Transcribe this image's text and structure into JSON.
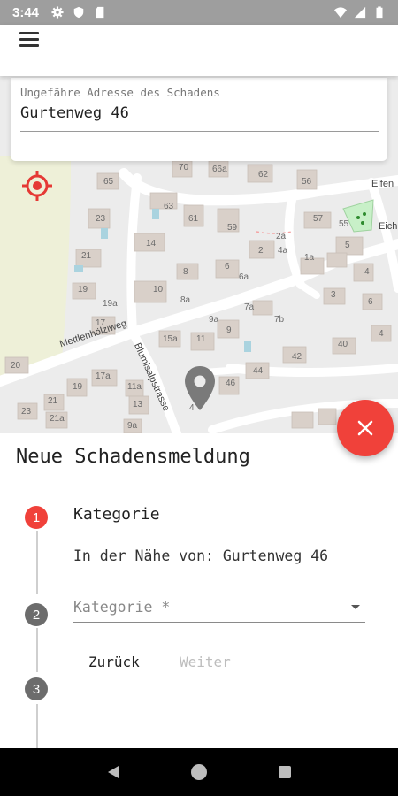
{
  "status_bar": {
    "time": "3:44",
    "left_icons": [
      "gear-icon",
      "shield-icon",
      "sd-card-icon"
    ],
    "right_icons": [
      "wifi-icon",
      "signal-icon",
      "battery-icon"
    ]
  },
  "app_bar": {
    "menu_icon": "hamburger-menu-icon"
  },
  "address": {
    "label": "Ungefähre Adresse des Schadens",
    "value": "Gurtenweg 46"
  },
  "map": {
    "street_labels": [
      "Mettlenhölziweg",
      "Blumisalpstrasse",
      "Elfen",
      "Eich"
    ],
    "house_numbers": [
      "70",
      "66a",
      "62",
      "56",
      "65",
      "63",
      "61",
      "59",
      "57",
      "55",
      "23",
      "2a",
      "2",
      "1a",
      "3",
      "5",
      "4",
      "21",
      "14",
      "8",
      "6",
      "6a",
      "4a",
      "19",
      "19a",
      "10",
      "8a",
      "7a",
      "7b",
      "6",
      "17",
      "9a",
      "11",
      "15a",
      "9",
      "40",
      "42",
      "4",
      "20",
      "19",
      "17a",
      "11a",
      "13",
      "46",
      "44",
      "21",
      "23",
      "21a",
      "9a",
      "4"
    ],
    "colors": {
      "background": "#ececec",
      "roads": "#ffffff",
      "buildings": "#d9d0c9",
      "park": "#eef0d8",
      "water": "#aad3df"
    }
  },
  "fab": {
    "icon": "close-icon",
    "color": "#f0413a"
  },
  "sheet": {
    "title": "Neue Schadensmeldung",
    "steps": [
      {
        "number": "1",
        "title": "Kategorie",
        "active": true
      },
      {
        "number": "2",
        "active": false
      },
      {
        "number": "3",
        "active": false
      }
    ],
    "near_text": "In der Nähe von: Gurtenweg 46",
    "category_placeholder": "Kategorie *",
    "back_label": "Zurück",
    "next_label": "Weiter"
  },
  "colors": {
    "accent": "#f0413a",
    "step_inactive": "#6c6c6c"
  },
  "nav_bar": {
    "icons": [
      "back-icon",
      "home-icon",
      "recents-icon"
    ]
  }
}
